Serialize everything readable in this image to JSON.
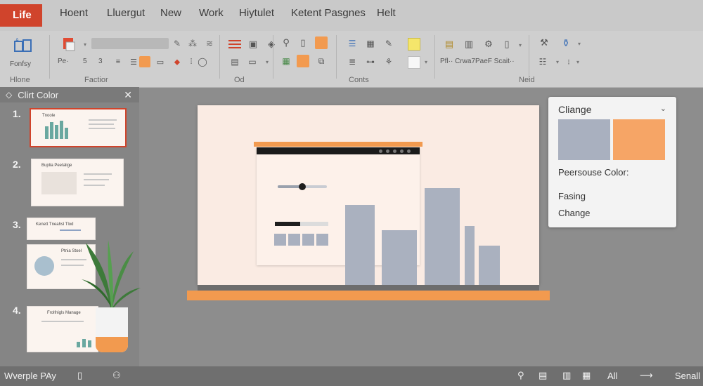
{
  "menu": {
    "tabs": [
      "Life",
      "Hoent",
      "Lluergut",
      "New",
      "Work",
      "Hiytulet",
      "Ketent Pasgnes",
      "Helt"
    ]
  },
  "ribbon": {
    "home_icon_label": "Fonfsy",
    "groups": [
      "Hlone",
      "Factior",
      "Od",
      "Conts",
      "Neid"
    ],
    "font_labels": [
      "Pe·",
      "5",
      "3"
    ],
    "para_text": "Pfl·· Crwa7PaeF Scait··"
  },
  "left_panel": {
    "title": "Clirt Color",
    "slide_numbers": [
      "1.",
      "2.",
      "3.",
      "4."
    ],
    "thumb_titles": [
      "Tnoole",
      "Buplia Peetalige",
      "Kenett Tneahsl Tlod",
      "Ptnia Stoel",
      "Frolfnigls Manage"
    ]
  },
  "popup": {
    "title": "Cliange",
    "swatch_colors": [
      "#a9b0bf",
      "#f6a566"
    ],
    "label": "Peersouse Color:",
    "items": [
      "Fasing",
      "Change"
    ]
  },
  "canvas": {
    "slider_value": 0.5,
    "progress_value": 0.48,
    "bar_color": "#aab1bf",
    "accent_color": "#f29a4f"
  },
  "status": {
    "left_label": "Wverple PAy",
    "right_labels": [
      "All",
      "Senall"
    ]
  },
  "colors": {
    "brand": "#d0442c",
    "accent": "#f29a4f",
    "bar": "#aab1bf"
  }
}
